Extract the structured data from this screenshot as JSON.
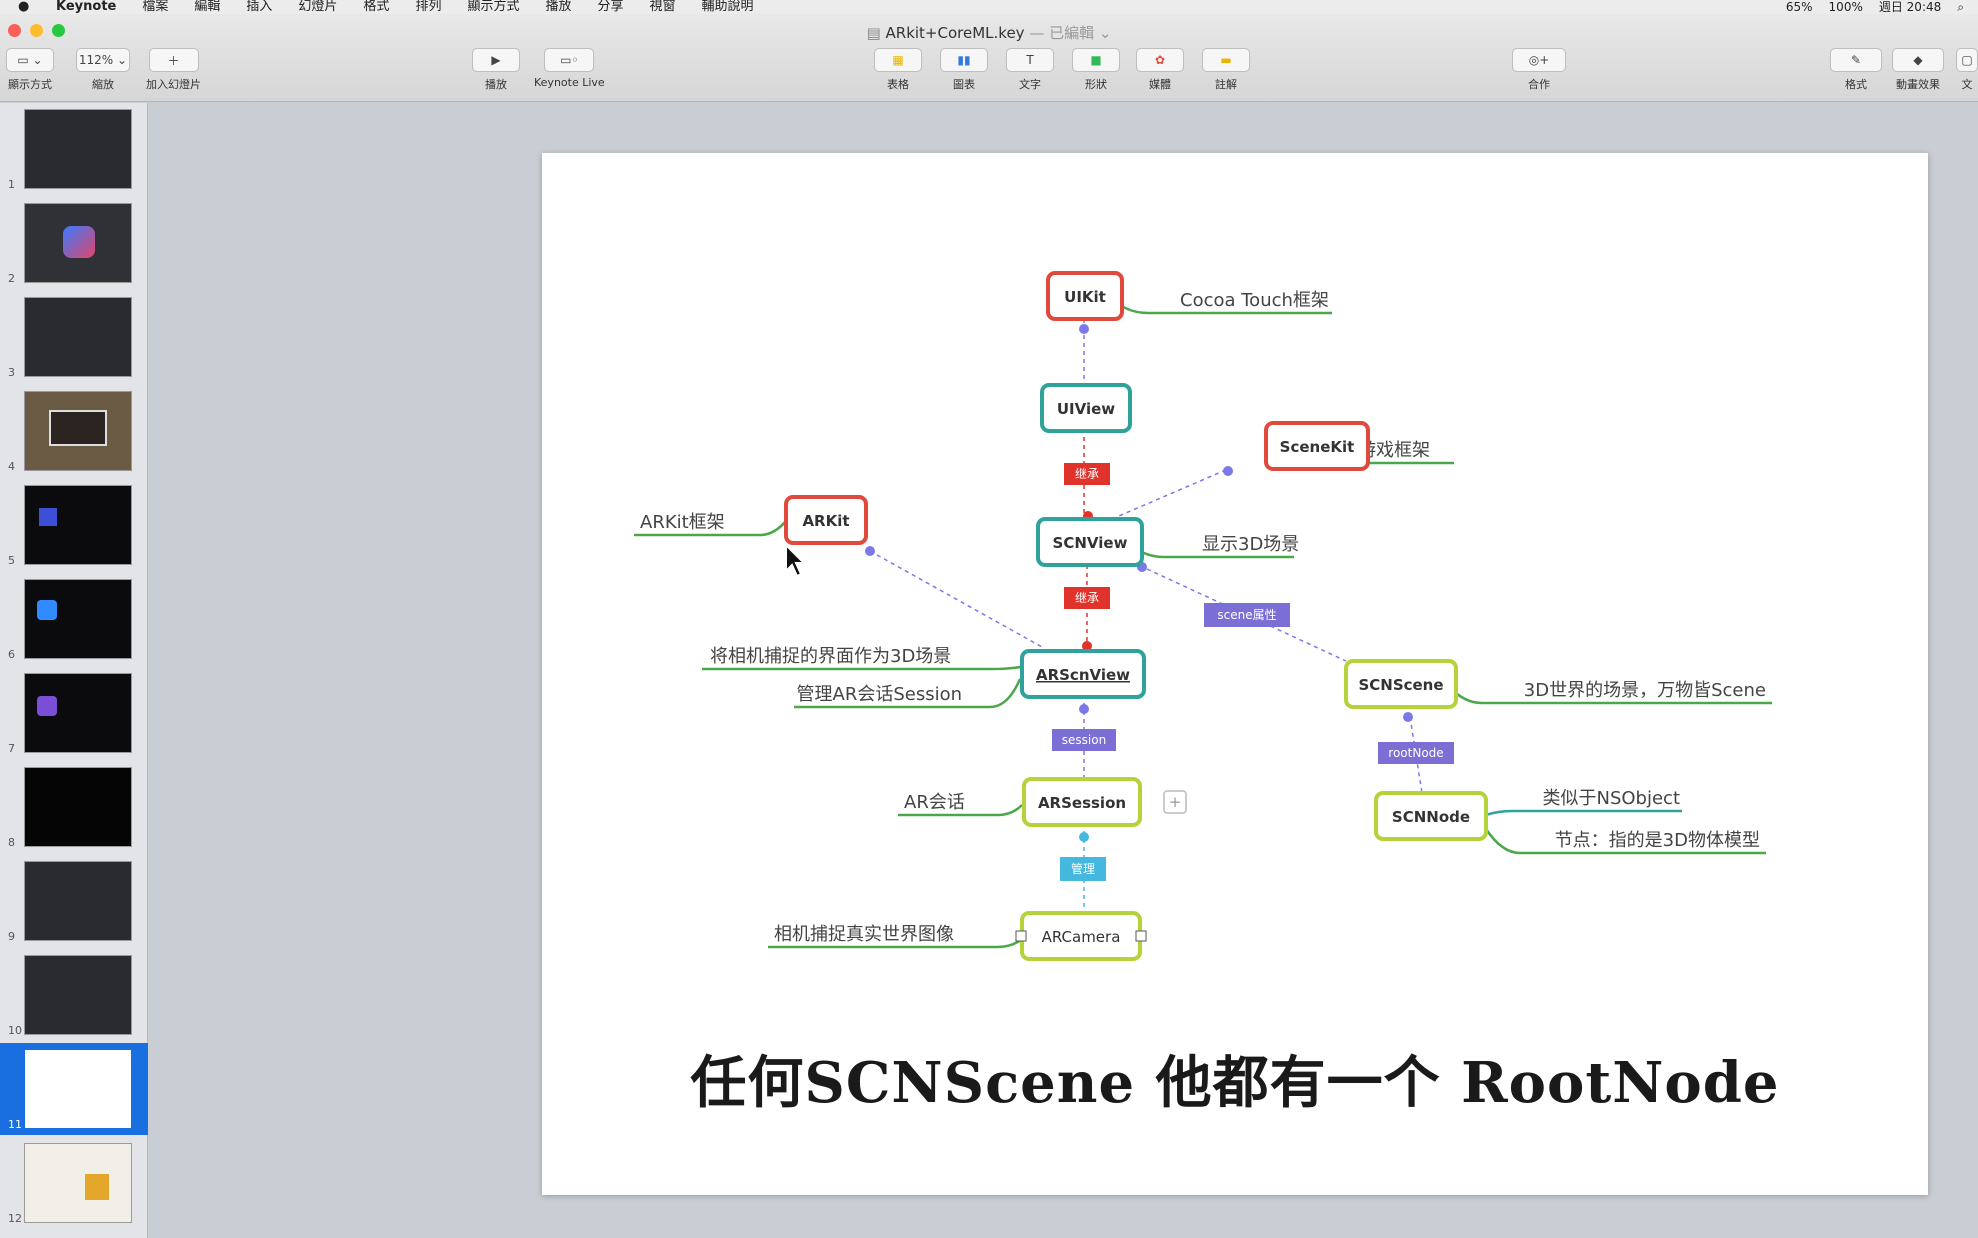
{
  "menubar": {
    "items": [
      "Keynote",
      "檔案",
      "編輯",
      "插入",
      "幻燈片",
      "格式",
      "排列",
      "顯示方式",
      "播放",
      "分享",
      "視窗",
      "輔助說明"
    ],
    "status": [
      "65%",
      "100%",
      "週日 20:48"
    ]
  },
  "window": {
    "title": "ARkit+CoreML.key",
    "edited": "— 已編輯 ⌄"
  },
  "toolbar": {
    "view_label": "顯示方式",
    "zoom_value": "112% ⌄",
    "zoom_label": "縮放",
    "add_slide_label": "加入幻燈片",
    "play_label": "播放",
    "keynote_live_label": "Keynote Live",
    "table_label": "表格",
    "chart_label": "圖表",
    "text_label": "文字",
    "shape_label": "形狀",
    "media_label": "媒體",
    "comment_label": "註解",
    "collaborate_label": "合作",
    "format_label": "格式",
    "animate_label": "動畫效果",
    "document_label": "文"
  },
  "slides": {
    "numbers": [
      "1",
      "2",
      "3",
      "4",
      "5",
      "6",
      "7",
      "8",
      "9",
      "10",
      "11",
      "12"
    ],
    "selected": "11"
  },
  "mindmap": {
    "nodes": {
      "uikit": "UIKit",
      "uiview": "UIView",
      "scenekit": "SceneKit",
      "arkit": "ARKit",
      "scnview": "SCNView",
      "arscnview": "ARScnView",
      "scnscene": "SCNScene",
      "arsession": "ARSession",
      "scnnode": "SCNNode",
      "arcamera": "ARCamera"
    },
    "notes": {
      "uikit": "Cocoa Touch框架",
      "scenekit": "3D游戏框架",
      "arkit": "ARKit框架",
      "scnview": "显示3D场景",
      "arscnview_1": "将相机捕捉的界面作为3D场景",
      "arscnview_2": "管理AR会话Session",
      "scnscene": "3D世界的场景，万物皆Scene",
      "arsession": "AR会话",
      "scnnode_1": "类似于NSObject",
      "scnnode_2": "节点：指的是3D物体模型",
      "arcamera": "相机捕捉真实世界图像"
    },
    "tags": {
      "inherit_1": "继承",
      "inherit_2": "继承",
      "scene_attr": "scene属性",
      "session": "session",
      "rootnode": "rootNode",
      "manage": "管理"
    },
    "colors": {
      "red": "#e04a3c",
      "teal": "#2fa39b",
      "lime": "#b5d23a",
      "green_line": "#4aa84a",
      "tag_red": "#e0332b",
      "tag_purple": "#7b6fd6",
      "tag_cyan": "#45b8e0",
      "dot": "#7b79e8"
    }
  },
  "caption": "任何SCNScene 他都有一个 RootNode"
}
